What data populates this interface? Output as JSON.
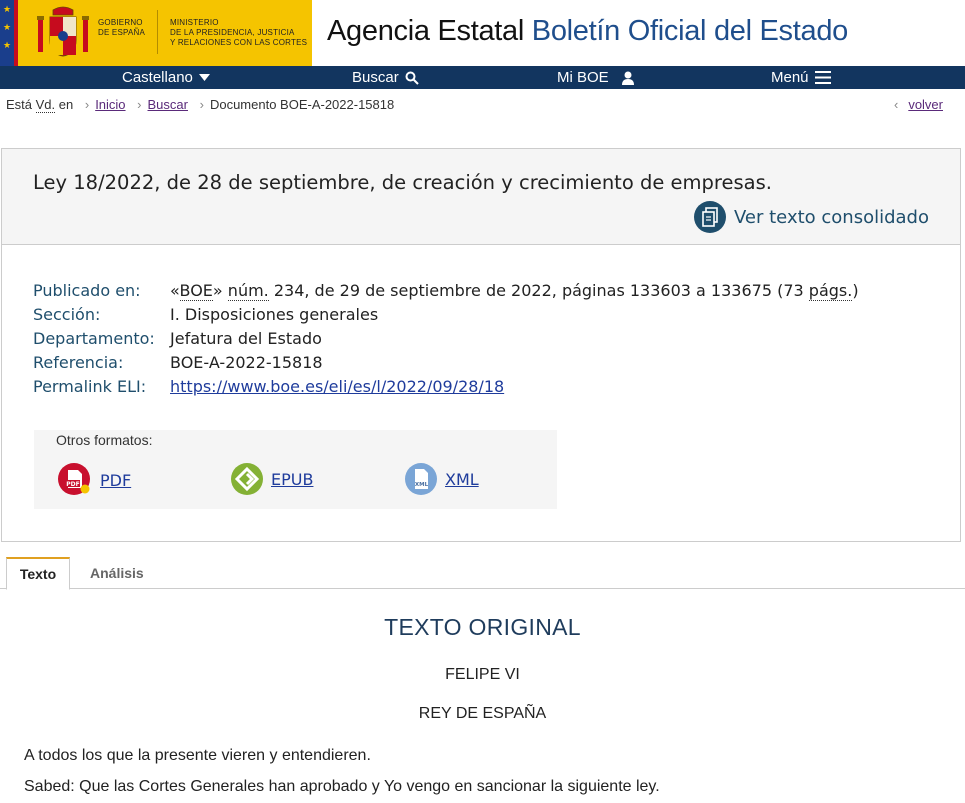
{
  "header": {
    "gov_line1": "GOBIERNO",
    "gov_line2": "DE ESPAÑA",
    "ministry_line1": "MINISTERIO",
    "ministry_line2": "DE LA PRESIDENCIA, JUSTICIA",
    "ministry_line3": "Y RELACIONES CON LAS CORTES",
    "title_plain": "Agencia Estatal ",
    "title_blue": "Boletín Oficial del Estado",
    "colors": {
      "gov_yellow": "#f5c400",
      "eu_blue": "#1a3e8c",
      "title_blue": "#1f4e8c"
    }
  },
  "nav": {
    "language": "Castellano",
    "search": "Buscar",
    "my_boe": "Mi BOE",
    "menu": "Menú",
    "bg_color": "#12355f"
  },
  "breadcrumb": {
    "prefix_a": "Está ",
    "prefix_abbr": "Vd.",
    "prefix_b": " en",
    "home": "Inicio",
    "search": "Buscar",
    "current": "Documento BOE-A-2022-15818",
    "back": "volver"
  },
  "document": {
    "title": "Ley 18/2022, de 28 de septiembre, de creación y crecimiento de empresas.",
    "consolidated_link": "Ver texto consolidado",
    "meta": {
      "published_label": "Publicado en:",
      "published_pre": "«",
      "published_abbr_boe": "BOE",
      "published_mid": "» ",
      "published_abbr_num": "núm.",
      "published_post": " 234, de 29 de septiembre de 2022, páginas 133603 a 133675 (73 ",
      "published_abbr_pags": "págs.",
      "published_end": ")",
      "section_label": "Sección:",
      "section_value": "I. Disposiciones generales",
      "department_label": "Departamento:",
      "department_value": "Jefatura del Estado",
      "reference_label": "Referencia:",
      "reference_value": "BOE-A-2022-15818",
      "eli_label": "Permalink ELI:",
      "eli_value": "https://www.boe.es/eli/es/l/2022/09/28/18"
    },
    "formats": {
      "title": "Otros formatos:",
      "pdf": "PDF",
      "epub": "EPUB",
      "xml": "XML"
    }
  },
  "tabs": {
    "texto": "Texto",
    "analisis": "Análisis"
  },
  "body": {
    "heading": "TEXTO ORIGINAL",
    "king": "FELIPE VI",
    "title": "REY DE ESPAÑA",
    "para1": "A todos los que la presente vieren y entendieren.",
    "para2": "Sabed: Que las Cortes Generales han aprobado y Yo vengo en sancionar la siguiente ley."
  }
}
